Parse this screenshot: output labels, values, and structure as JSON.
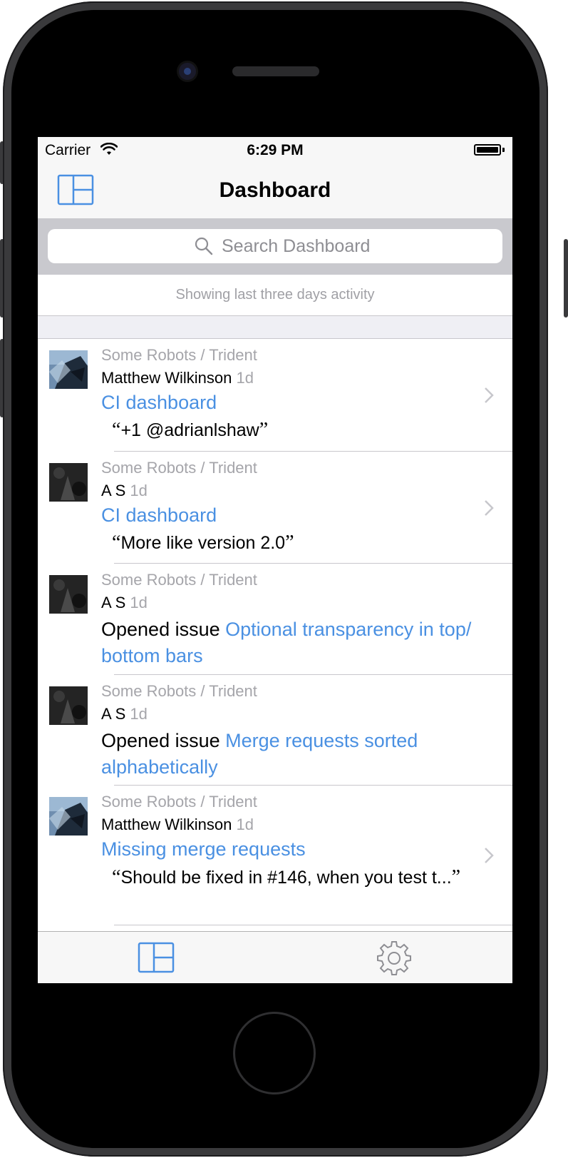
{
  "status_bar": {
    "carrier": "Carrier",
    "time": "6:29 PM"
  },
  "nav": {
    "title": "Dashboard",
    "left_icon": "dashboard-layout-icon"
  },
  "search": {
    "placeholder": "Search Dashboard"
  },
  "info": {
    "text": "Showing last three days activity"
  },
  "feed": [
    {
      "project": "Some Robots / Trident",
      "user": "Matthew Wilkinson",
      "ago": "1d",
      "title": "CI dashboard",
      "quote": "+1 @adrianlshaw",
      "avatar": "photo"
    },
    {
      "project": "Some Robots / Trident",
      "user": "A S",
      "ago": "1d",
      "title": "CI dashboard",
      "quote": "More like version 2.0",
      "avatar": "dark"
    },
    {
      "project": "Some Robots / Trident",
      "user": "A S",
      "ago": "1d",
      "action": "Opened issue",
      "issue_title": "Optional transparency in top/ bottom bars",
      "avatar": "dark"
    },
    {
      "project": "Some Robots / Trident",
      "user": "A S",
      "ago": "1d",
      "action": "Opened issue",
      "issue_title": "Merge requests sorted alphabetically",
      "avatar": "dark"
    },
    {
      "project": "Some Robots / Trident",
      "user": "Matthew Wilkinson",
      "ago": "1d",
      "title": "Missing merge requests",
      "quote": "Should be fixed in #146, when you test t...",
      "avatar": "photo"
    }
  ],
  "tab_bar": {
    "tabs": [
      {
        "icon": "dashboard-layout-icon",
        "selected": true
      },
      {
        "icon": "gear-icon",
        "selected": false
      }
    ]
  },
  "colors": {
    "accent": "#4a90e2",
    "secondary_text": "#a5a5aa",
    "separator": "#c8c7cc",
    "search_bar_bg": "#c9c9ce",
    "tab_inactive": "#8e8e93"
  }
}
